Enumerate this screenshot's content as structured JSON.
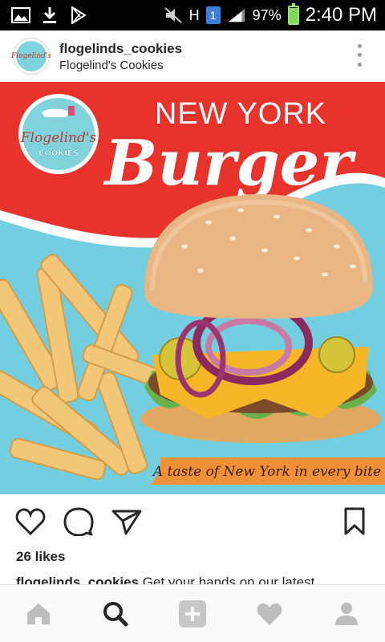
{
  "status_bar": {
    "battery_percent": "97%",
    "battery_level": 0.97,
    "time": "2:40 PM",
    "sim_label": "1",
    "network_label": "H",
    "icons": [
      "gallery-icon",
      "download-icon",
      "play-store-icon",
      "mute-icon",
      "signal-icon",
      "battery-icon"
    ]
  },
  "post": {
    "username": "flogelinds_cookies",
    "display_name": "Flogelind's Cookies",
    "avatar_text": "Flogelind's",
    "image": {
      "headline_top": "NEW YORK",
      "headline_main": "Burger",
      "tagline": "A taste of New York in every bite",
      "logo_line1": "Flogelind's",
      "logo_line2": "COOKIES"
    },
    "likes": "26 likes",
    "caption_user": "flogelinds_cookies",
    "caption_text": " Get your hands on our latest"
  },
  "colors": {
    "banner_red": "#e8322c",
    "sky_blue": "#6fcfe0",
    "tagline_orange": "#f0913a",
    "link": "#262626"
  },
  "bottom_nav": {
    "items": [
      "home-icon",
      "search-icon",
      "add-icon",
      "heart-icon",
      "profile-icon"
    ]
  }
}
